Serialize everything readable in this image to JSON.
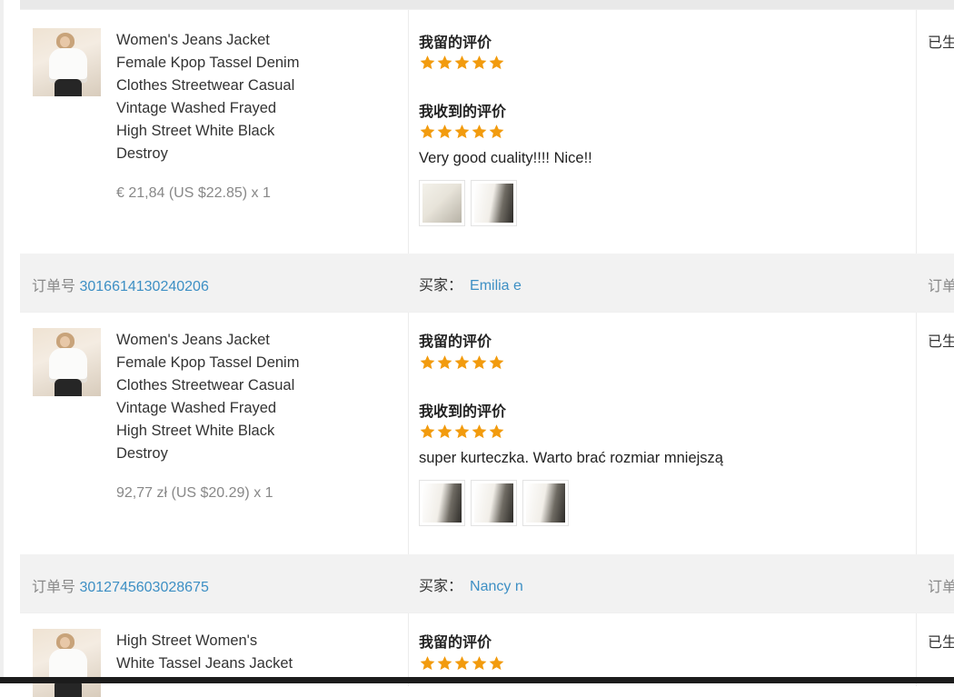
{
  "orders": [
    {
      "product_title_lines": [
        "Women's Jeans Jacket",
        "Female Kpop Tassel Denim",
        "Clothes Streetwear Casual",
        "Vintage Washed Frayed",
        "High Street White Black",
        "Destroy"
      ],
      "price": "€ 21,84 (US $22.85) x 1",
      "my_review_label": "我留的评价",
      "my_rating": 5,
      "received_review_label": "我收到的评价",
      "received_rating": 5,
      "comment": "Very good cuality!!!! Nice!!",
      "photos": [
        "review-photo-1",
        "review-photo-2"
      ],
      "status": "已生"
    },
    {
      "order_label": "订单号",
      "order_number": "3016614130240206",
      "buyer_label": "买家：",
      "buyer_name": "Emilia e",
      "right_label": "订单",
      "product_title_lines": [
        "Women's Jeans Jacket",
        "Female Kpop Tassel Denim",
        "Clothes Streetwear Casual",
        "Vintage Washed Frayed",
        "High Street White Black",
        "Destroy"
      ],
      "price": "92,77 zł (US $20.29) x 1",
      "my_review_label": "我留的评价",
      "my_rating": 5,
      "received_review_label": "我收到的评价",
      "received_rating": 5,
      "comment": "super kurteczka. Warto brać rozmiar mniejszą",
      "photos": [
        "review-photo-1",
        "review-photo-2",
        "review-photo-3"
      ],
      "status": "已生"
    },
    {
      "order_label": "订单号",
      "order_number": "3012745603028675",
      "buyer_label": "买家：",
      "buyer_name": "Nancy n",
      "right_label": "订单",
      "product_title_lines": [
        "High Street Women's",
        "White Tassel Jeans Jacket"
      ],
      "my_review_label": "我留的评价",
      "my_rating": 5,
      "status": "已生"
    }
  ],
  "colors": {
    "star": "#f29b0e",
    "link": "#3d8fc4",
    "header_bg": "#f2f2f2"
  },
  "icons": {
    "star": "star-icon"
  }
}
